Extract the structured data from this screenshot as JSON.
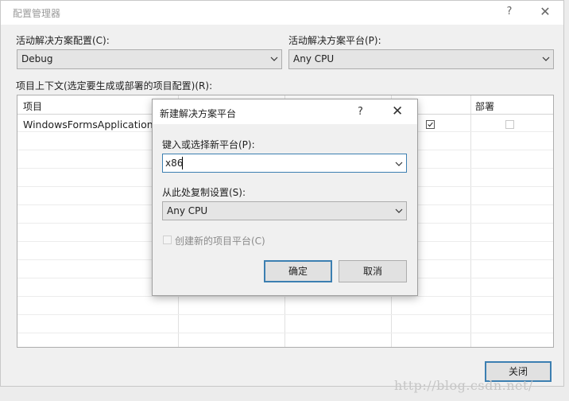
{
  "window": {
    "title": "配置管理器",
    "help_glyph": "?",
    "close_glyph": "✕",
    "active_config_label": "活动解决方案配置(C):",
    "active_config_value": "Debug",
    "active_platform_label": "活动解决方案平台(P):",
    "active_platform_value": "Any CPU",
    "context_label": "项目上下文(选定要生成或部署的项目配置)(R):",
    "close_button_label": "关闭"
  },
  "grid": {
    "columns": [
      "项目",
      "",
      "",
      "",
      "部署"
    ],
    "rows": [
      {
        "project": "WindowsFormsApplication2",
        "build_checked": true,
        "deploy_checked": false
      }
    ]
  },
  "dialog": {
    "title": "新建解决方案平台",
    "help_glyph": "?",
    "close_glyph": "✕",
    "new_platform_label": "键入或选择新平台(P):",
    "new_platform_value": "x86",
    "copy_from_label": "从此处复制设置(S):",
    "copy_from_value": "Any CPU",
    "create_project_platforms_label": "创建新的项目平台(C)",
    "create_project_platforms_checked": false,
    "ok_label": "确定",
    "cancel_label": "取消"
  },
  "watermark": "http://blog.csdn.net/",
  "colors": {
    "accent": "#3c7fb1",
    "dialog_bg": "#f0f0f0"
  }
}
